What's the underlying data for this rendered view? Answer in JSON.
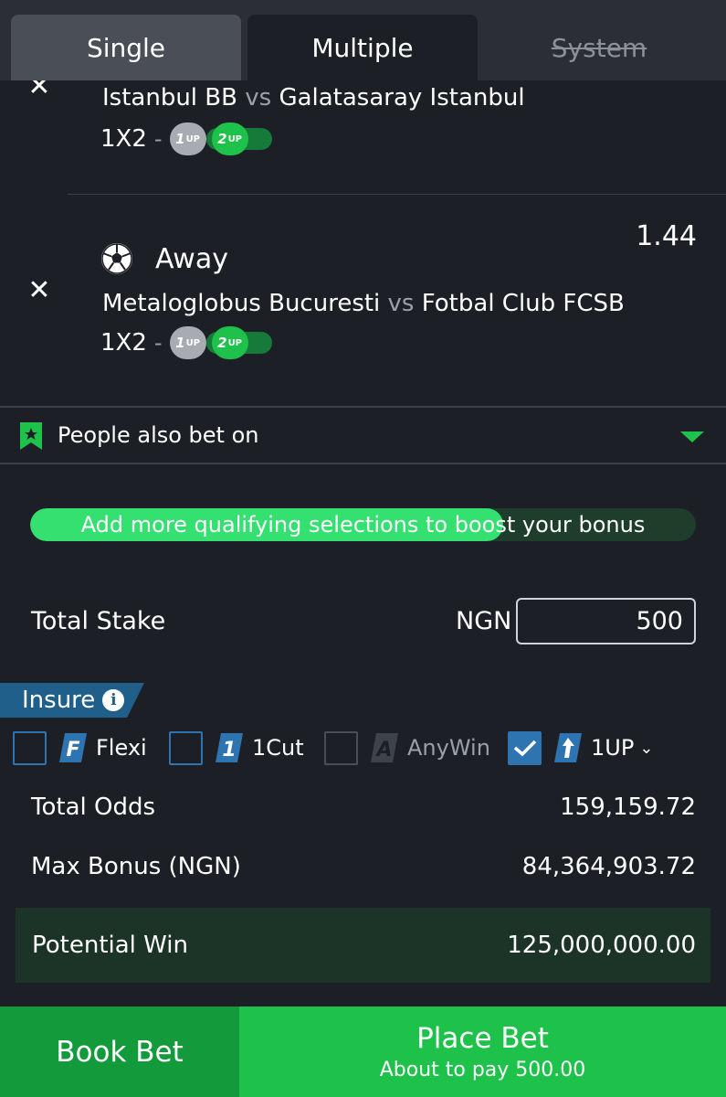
{
  "tabs": [
    {
      "label": "Single"
    },
    {
      "label": "Multiple"
    },
    {
      "label": "System"
    }
  ],
  "bets": [
    {
      "home": "Istanbul BB",
      "vs": "vs",
      "away": "Galatasaray Istanbul",
      "market": "1X2",
      "chip1": "1",
      "chip2": "2",
      "chip_suffix": "UP"
    },
    {
      "pick": "Away",
      "odds": "1.44",
      "home": "Metaloglobus Bucuresti",
      "vs": "vs",
      "away": "Fotbal Club FCSB",
      "market": "1X2",
      "chip1": "1",
      "chip2": "2",
      "chip_suffix": "UP"
    }
  ],
  "people_also_bet": {
    "label": "People also bet on"
  },
  "bonus": {
    "text": "Add more qualifying selections to boost your bonus",
    "progress_fraction": 0.71
  },
  "stake": {
    "label": "Total Stake",
    "currency": "NGN",
    "value": "500"
  },
  "insure": {
    "label": "Insure",
    "info": "i"
  },
  "options": [
    {
      "label": "Flexi",
      "checked": false,
      "disabled": false
    },
    {
      "label": "1Cut",
      "checked": false,
      "disabled": false
    },
    {
      "label": "AnyWin",
      "checked": false,
      "disabled": true
    },
    {
      "label": "1UP",
      "checked": true,
      "disabled": false
    }
  ],
  "summary": {
    "total_odds_label": "Total Odds",
    "total_odds_value": "159,159.72",
    "max_bonus_label": "Max Bonus (NGN)",
    "max_bonus_value": "84,364,903.72",
    "potential_win_label": "Potential Win",
    "potential_win_value": "125,000,000.00"
  },
  "actions": {
    "book_label": "Book Bet",
    "place_label": "Place Bet",
    "place_sub": "About to pay 500.00"
  },
  "colors": {
    "background": "#1c1f26",
    "accent_green": "#1ec14a",
    "insure_blue": "#1f5f8a"
  }
}
